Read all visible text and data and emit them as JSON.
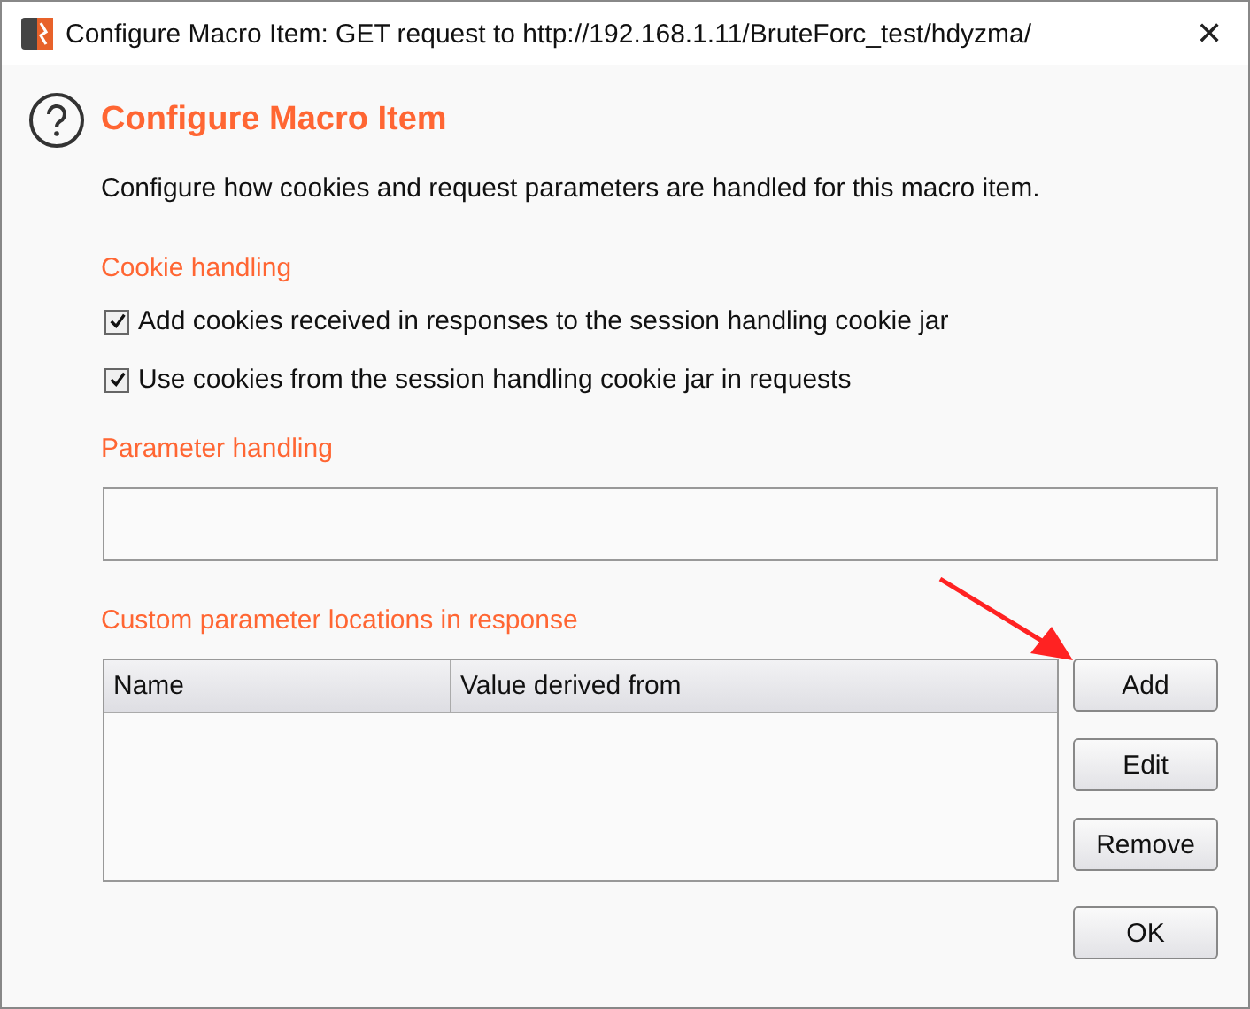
{
  "window": {
    "title": "Configure Macro Item: GET request to http://192.168.1.11/BruteForc_test/hdyzma/",
    "close": "✕"
  },
  "heading": "Configure Macro Item",
  "description": "Configure how cookies and request parameters are handled for this macro item.",
  "cookie_handling": {
    "label": "Cookie handling",
    "options": [
      {
        "label": "Add cookies received in responses to the session handling cookie jar",
        "checked": true
      },
      {
        "label": "Use cookies from the session handling cookie jar in requests",
        "checked": true
      }
    ]
  },
  "parameter_handling": {
    "label": "Parameter handling"
  },
  "custom_locations": {
    "label": "Custom parameter locations in response",
    "columns": [
      "Name",
      "Value derived from"
    ],
    "buttons": [
      "Add",
      "Edit",
      "Remove"
    ]
  },
  "buttons": [
    "OK"
  ]
}
